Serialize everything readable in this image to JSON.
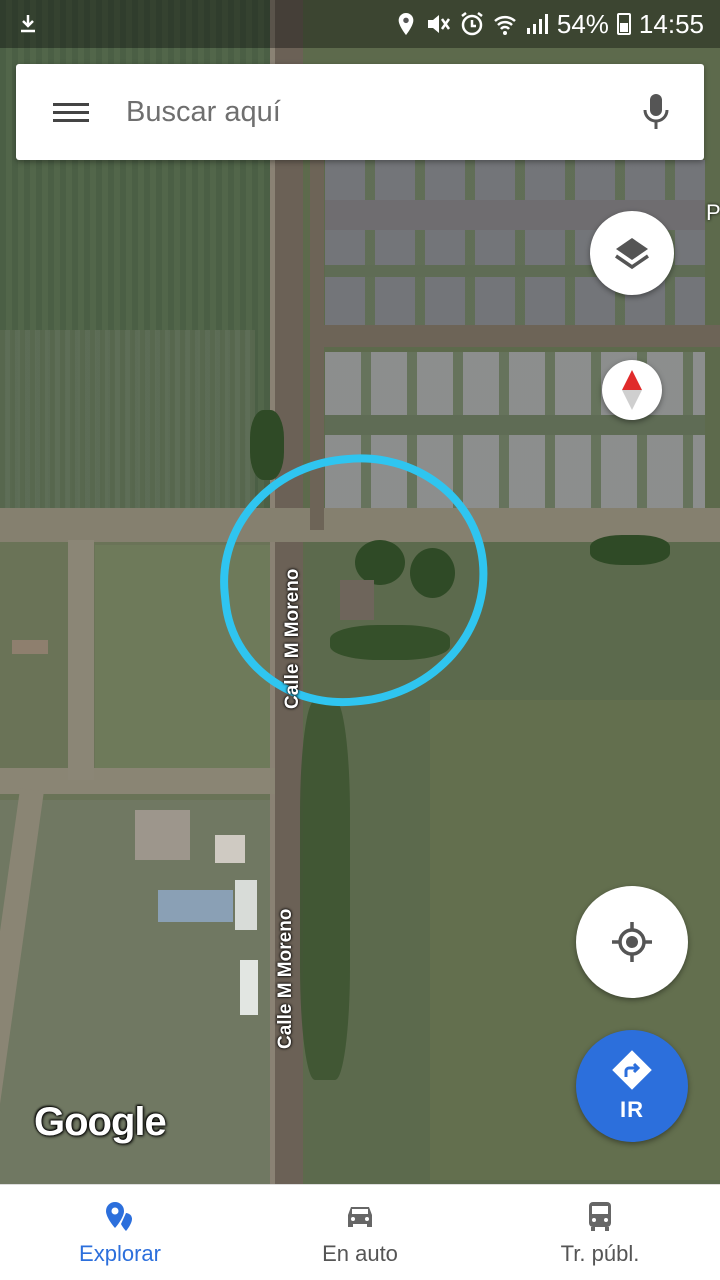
{
  "status_bar": {
    "battery": "54%",
    "time": "14:55"
  },
  "search": {
    "placeholder": "Buscar aquí"
  },
  "map": {
    "street_labels": [
      "Calle M Moreno",
      "Calle M Moreno"
    ],
    "edge_label": "P",
    "attribution": "Google",
    "annotation_color": "#2fc5f0"
  },
  "buttons": {
    "layers_icon": "layers-icon",
    "compass_icon": "compass-icon",
    "locate_icon": "my-location-icon",
    "go_label": "IR"
  },
  "bottom_nav": {
    "tabs": [
      {
        "label": "Explorar",
        "icon": "explore-pin-icon",
        "active": true
      },
      {
        "label": "En auto",
        "icon": "car-icon",
        "active": false
      },
      {
        "label": "Tr. públ.",
        "icon": "bus-icon",
        "active": false
      }
    ]
  },
  "colors": {
    "accent": "#2c6fdc"
  }
}
